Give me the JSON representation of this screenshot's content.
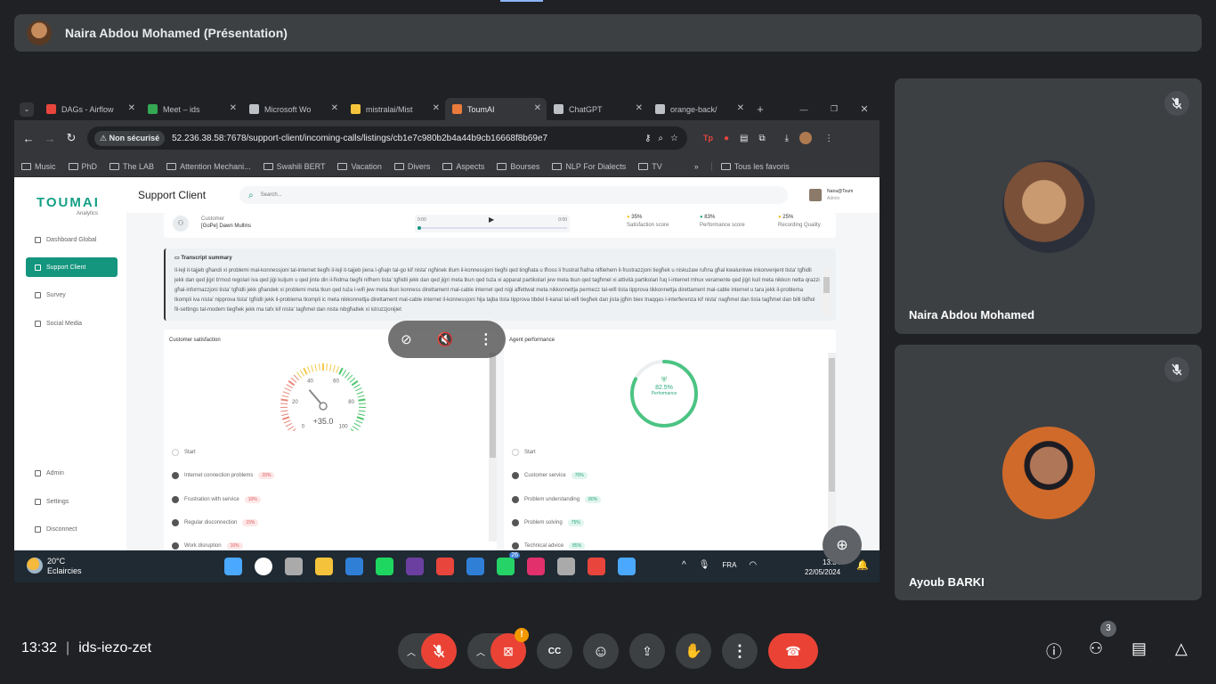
{
  "presenter": {
    "name": "Naira Abdou Mohamed (Présentation)"
  },
  "browser": {
    "tabs": [
      {
        "label": "DAGs - Airflow",
        "color": "#e8453c"
      },
      {
        "label": "Meet – ids",
        "color": "#34a853"
      },
      {
        "label": "Microsoft Wo",
        "color": "#bdc1c6"
      },
      {
        "label": "mistralai/Mist",
        "color": "#f5c33b"
      },
      {
        "label": "ToumAI",
        "color": "#e87a3c"
      },
      {
        "label": "ChatGPT",
        "color": "#bdc1c6"
      },
      {
        "label": "orange-back/",
        "color": "#bdc1c6"
      }
    ],
    "security_label": "Non sécurisé",
    "url": "52.236.38.58:7678/support-client/incoming-calls/listings/cb1e7c980b2b4a44b9cb16668f8b69e7",
    "bookmarks": [
      "Music",
      "PhD",
      "The LAB",
      "Attention Mechani...",
      "Swahili BERT",
      "Vacation",
      "Divers",
      "Aspects",
      "Bourses",
      "NLP For Dialects",
      "TV"
    ],
    "all_bookmarks": "Tous les favoris"
  },
  "app": {
    "logo": "TOUMAI",
    "logo_sub": "Analytics",
    "nav": [
      "Dashboard Global",
      "Support Client",
      "Survey",
      "Social Media"
    ],
    "nav_bottom": [
      "Admin",
      "Settings",
      "Disconnect"
    ],
    "page_title": "Support Client",
    "search_placeholder": "Search...",
    "user_name": "Naira@Toum",
    "user_role": "Admin",
    "customer_label": "Customer",
    "customer_name": "[GoPe] Dawn Mullins",
    "audio_start": "0:00",
    "audio_end": "0:00",
    "scores": [
      {
        "value": "35%",
        "label": "Satisfaction score",
        "color": "#f2c230"
      },
      {
        "value": "83%",
        "label": "Performance score",
        "color": "#2aa77e"
      },
      {
        "value": "25%",
        "label": "Recording Quality",
        "color": "#f2c230"
      }
    ],
    "transcript_title": "Transcript summary",
    "transcript": "Il-lejl it-tajjeb għandi xi problemi mal-konnessjoni tal-internet tiegħi il-lejl it-tajjeb jiena l-għajn tal-go kif nista' ngħinek illum il-konnessjoni tiegħi qed tingħata u tħoss li frustrat ħafna niftiehem il-frustrazzjoni tiegħek u niskużaw ruħna għal kwalunkwe inkonvenjent tista' tgħidli jekk dan qed jiġri b'mod regolari iva qed jiġi kuljum u qed jinte din il-ħidma tiegħi nifhem tista' tgħidli jekk dan qed jiġri meta tkun qed tuża xi apparat partikolari jew meta tkun qed tagħmel xi attività partikolari fuq l-internet mhux veramente qed jiġri kull meta nikkon netta qrazzi għal-informazzjoni tista' tgħidli jekk għandek xi problemi meta tkun qed tuża l-wifi jew meta tkun konness direttament mal-cable internet qed niġi affettwat meta nikkonnettja permezz tal-wifi tista tipprova tikkonnettja direttament mal-cable internet u tara jekk il-problema tkompli iva nista' nipprova tista' tgħidli jekk il-problema tkompli ic meta nikkonnettja direttament mal-cable internet il-konnessjoni hija tajba tista tipprova tibdel il-kanal tal-wifi tiegħek dan jista jgħin biex tnaqqas l-interferenza kif nista' nagħmel dan tista tagħmel dan billi tidħol fil-settings tal-modem tiegħek jekk ma tafx kif nista' tagħmel dan nista nibgħatlek xi istruzzjonijiet",
    "cs_title": "Customer satisfaction",
    "gauge_value": "+35.0",
    "gauge_ticks": [
      "0",
      "20",
      "40",
      "60",
      "80",
      "100"
    ],
    "cs_timeline": [
      {
        "label": "Start",
        "badge": ""
      },
      {
        "label": "Internet connection problems",
        "badge": "20%"
      },
      {
        "label": "Frustration with service",
        "badge": "10%"
      },
      {
        "label": "Regular disconnection",
        "badge": "15%"
      },
      {
        "label": "Work disruption",
        "badge": "10%"
      }
    ],
    "ap_title": "Agent performance",
    "perf_value": "82.5%",
    "perf_label": "Performance",
    "perf_fraction": 0.825,
    "ap_timeline": [
      {
        "label": "Start",
        "badge": ""
      },
      {
        "label": "Customer service",
        "badge": "70%"
      },
      {
        "label": "Problem understanding",
        "badge": "80%"
      },
      {
        "label": "Problem solving",
        "badge": "75%"
      },
      {
        "label": "Technical advice",
        "badge": "85%"
      }
    ]
  },
  "taskbar": {
    "temp": "20°C",
    "weather": "Eclaircies",
    "lang": "FRA",
    "time": "13:34",
    "date": "22/05/2024",
    "whatsapp_count": "26"
  },
  "participants": [
    {
      "name": "Naira Abdou Mohamed"
    },
    {
      "name": "Ayoub BARKI"
    }
  ],
  "meeting": {
    "time": "13:32",
    "code": "ids-iezo-zet",
    "people_count": "3",
    "alert": "!"
  }
}
